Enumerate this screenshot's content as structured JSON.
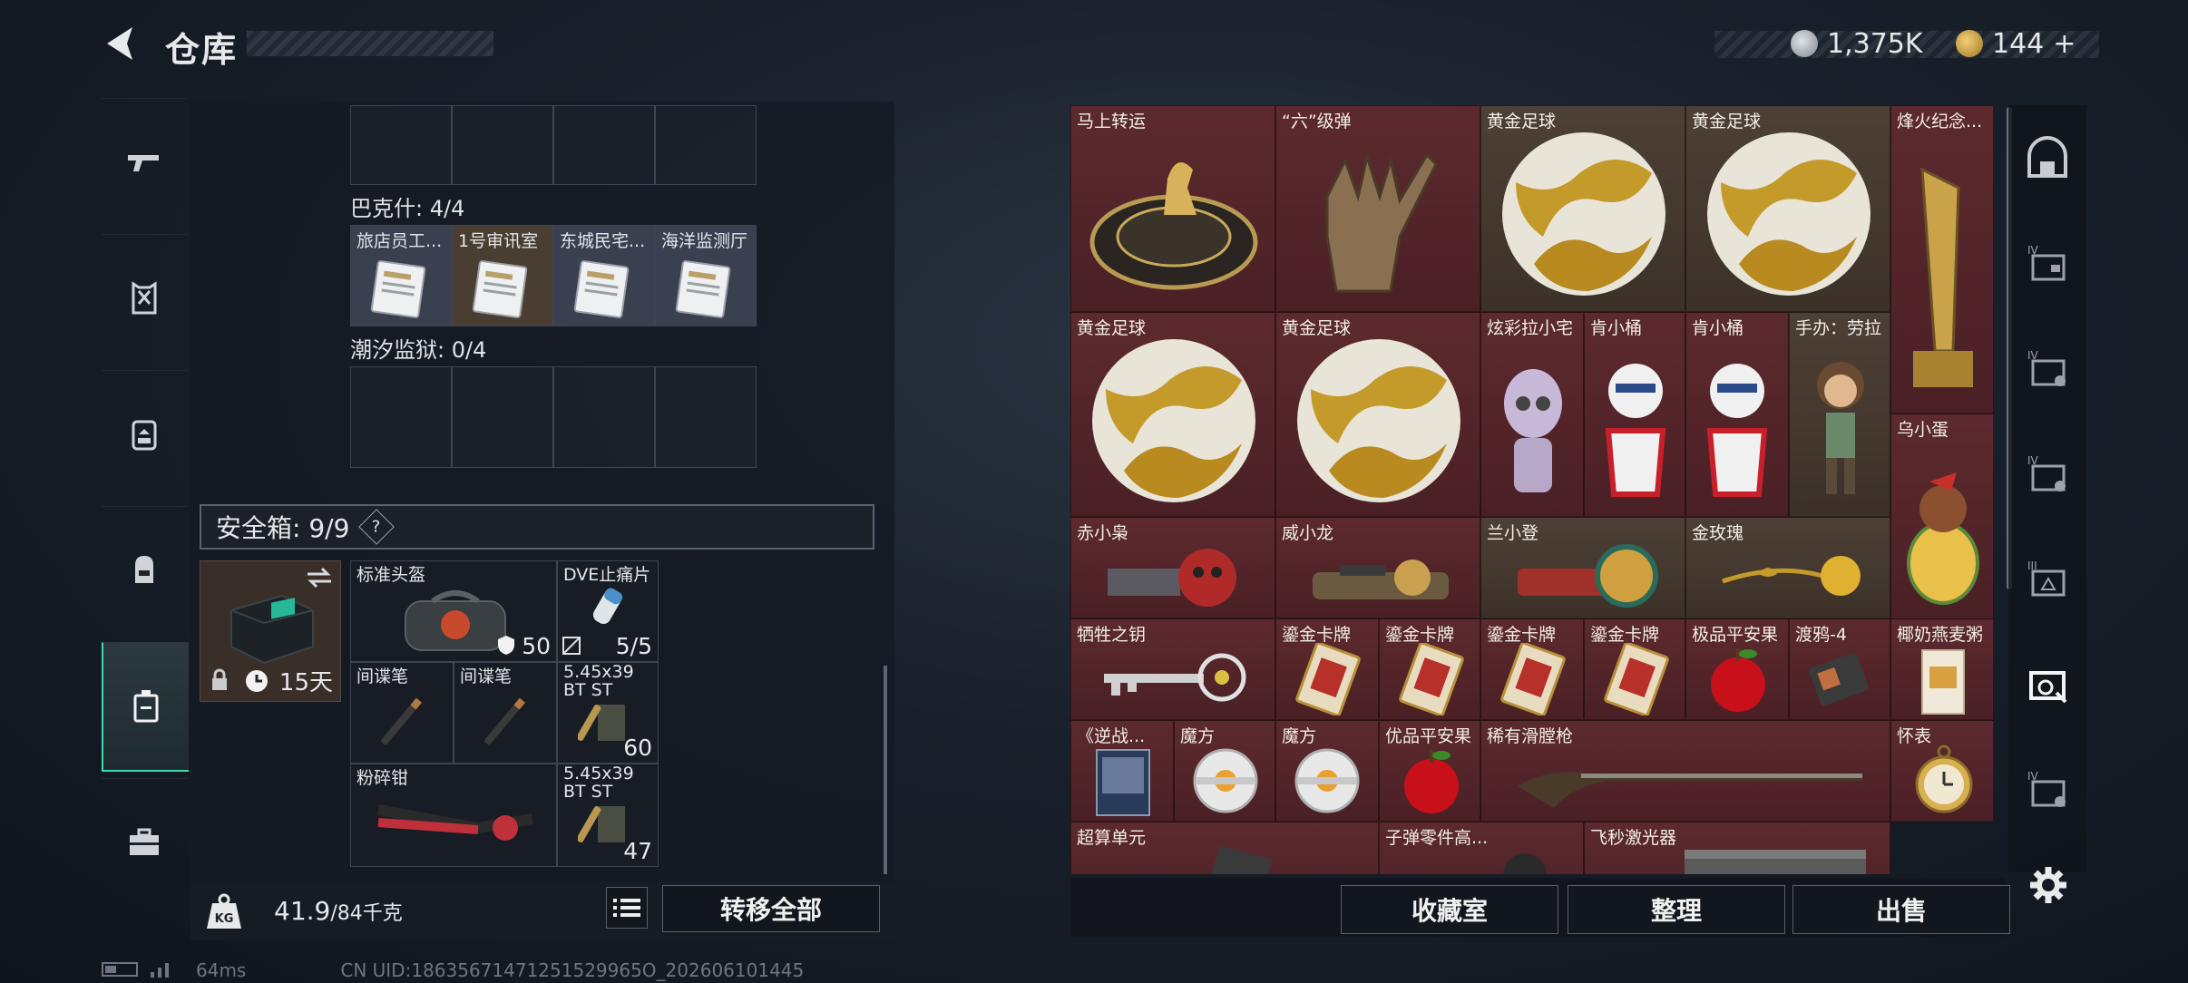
{
  "header": {
    "title": "仓库",
    "currency1": "1,375K",
    "currency2": "144",
    "currency2_plus": "+"
  },
  "left_sidebar": {
    "items": [
      {
        "name": "weapon-tab-icon"
      },
      {
        "name": "armor-tab-icon"
      },
      {
        "name": "backpack-tab-icon"
      },
      {
        "name": "bag-tab-icon"
      },
      {
        "name": "container-tab-icon",
        "active": true
      },
      {
        "name": "toolbox-tab-icon"
      }
    ]
  },
  "keycard_sections": {
    "bakesh": "巴克什: 4/4",
    "bakesh_cards": [
      "旅店员工...",
      "1号审讯室",
      "东城民宅...",
      "海洋监测厅"
    ],
    "chaoxi": "潮汐监狱: 0/4"
  },
  "safe_box": {
    "label": "安全箱: 9/9",
    "help": "?",
    "box_days": "15天",
    "items": [
      {
        "name": "标准头盔",
        "value": "50"
      },
      {
        "name": "DVE止痛片",
        "value": "5/5"
      },
      {
        "name": "间谍笔"
      },
      {
        "name": "间谍笔"
      },
      {
        "name": "5.45x39 BT ST",
        "value": "60"
      },
      {
        "name": "粉碎钳"
      },
      {
        "name": "5.45x39 BT ST",
        "value": "47"
      }
    ]
  },
  "weight": {
    "current": "41.9",
    "max": "/84千克"
  },
  "buttons": {
    "transfer_all": "转移全部",
    "collection": "收藏室",
    "sort": "整理",
    "sell": "出售"
  },
  "status": {
    "ping": "64ms",
    "uid": "CN UID:18635671471251529965O_202606101445"
  },
  "collection_items": [
    {
      "label": "马上转运"
    },
    {
      "label": "“六”级弹"
    },
    {
      "label": "黄金足球"
    },
    {
      "label": "黄金足球"
    },
    {
      "label": "烽火纪念..."
    },
    {
      "label": "黄金足球"
    },
    {
      "label": "黄金足球"
    },
    {
      "label": "炫彩拉小宅"
    },
    {
      "label": "肯小桶"
    },
    {
      "label": "肯小桶"
    },
    {
      "label": "手办：劳拉"
    },
    {
      "label": "乌小蛋"
    },
    {
      "label": "赤小枭"
    },
    {
      "label": "威小龙"
    },
    {
      "label": "兰小登"
    },
    {
      "label": "金玫瑰"
    },
    {
      "label": "牺牲之钥"
    },
    {
      "label": "鎏金卡牌"
    },
    {
      "label": "鎏金卡牌"
    },
    {
      "label": "鎏金卡牌"
    },
    {
      "label": "鎏金卡牌"
    },
    {
      "label": "极品平安果"
    },
    {
      "label": "渡鸦-4"
    },
    {
      "label": "椰奶燕麦粥"
    },
    {
      "label": "《逆战..."
    },
    {
      "label": "魔方"
    },
    {
      "label": "魔方"
    },
    {
      "label": "优品平安果"
    },
    {
      "label": "稀有滑膛枪"
    },
    {
      "label": "怀表"
    },
    {
      "label": "超算单元"
    },
    {
      "label": "子弹零件高..."
    },
    {
      "label": "飞秒激光器"
    }
  ]
}
